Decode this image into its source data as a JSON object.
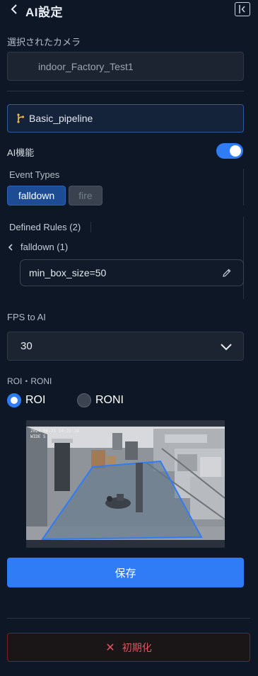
{
  "header": {
    "title": "AI設定",
    "back_icon": "chevron-left-icon",
    "collapse_icon": "sidebar-collapse-icon"
  },
  "camera": {
    "label": "選択されたカメラ",
    "value": "indoor_Factory_Test1"
  },
  "pipeline": {
    "name": "Basic_pipeline",
    "icon": "branch-icon"
  },
  "ai_toggle": {
    "label": "AI機能",
    "on": true
  },
  "event_types": {
    "label": "Event Types",
    "items": [
      {
        "label": "falldown",
        "selected": true
      },
      {
        "label": "fire",
        "selected": false
      }
    ]
  },
  "rules": {
    "label": "Defined Rules (2)",
    "group_label": "falldown (1)",
    "rule_value": "min_box_size=50"
  },
  "fps": {
    "label": "FPS to AI",
    "value": "30"
  },
  "roi": {
    "label": "ROI・RONI",
    "options": [
      {
        "label": "ROI",
        "selected": true
      },
      {
        "label": "RONI",
        "selected": false
      }
    ]
  },
  "preview": {
    "overlay_line1": "2024-06-21 14:21:19",
    "overlay_line2": "WIDE 5",
    "roi_color": "#2f7cf6"
  },
  "actions": {
    "save_label": "保存",
    "reset_label": "初期化"
  },
  "colors": {
    "accent": "#2f7cf6",
    "danger": "#e05560",
    "background": "#0e1726"
  }
}
